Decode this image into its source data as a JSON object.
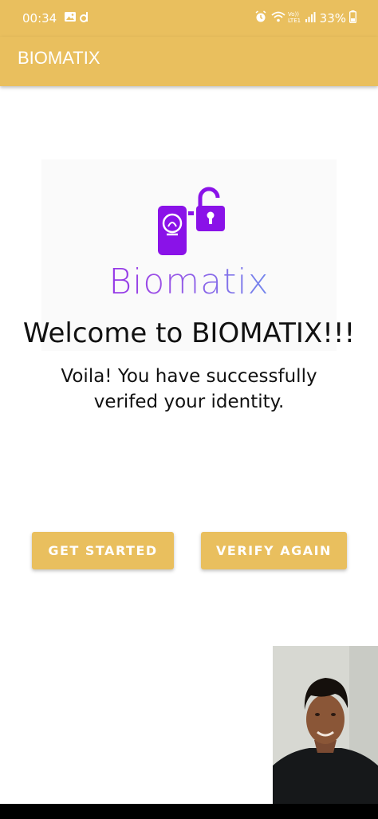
{
  "status_bar": {
    "time": "00:34",
    "signal_text": "Vo)) LTE1",
    "battery": "33%",
    "icons": [
      "gallery-icon",
      "d-app-icon",
      "alarm-icon",
      "wifi-icon",
      "signal-icon",
      "battery-icon"
    ]
  },
  "app_bar": {
    "title": "BIOMATIX"
  },
  "logo": {
    "wordmark": "Biomatix"
  },
  "welcome": {
    "title": "Welcome to BIOMATIX!!!",
    "message_line1": "Voila! You have successfully",
    "message_line2": "verifed your identity."
  },
  "buttons": {
    "get_started": "GET STARTED",
    "verify_again": "VERIFY AGAIN"
  },
  "colors": {
    "accent": "#e9bf5e",
    "logo_purple": "#8a12e8",
    "logo_blue": "#5aa9f0"
  }
}
